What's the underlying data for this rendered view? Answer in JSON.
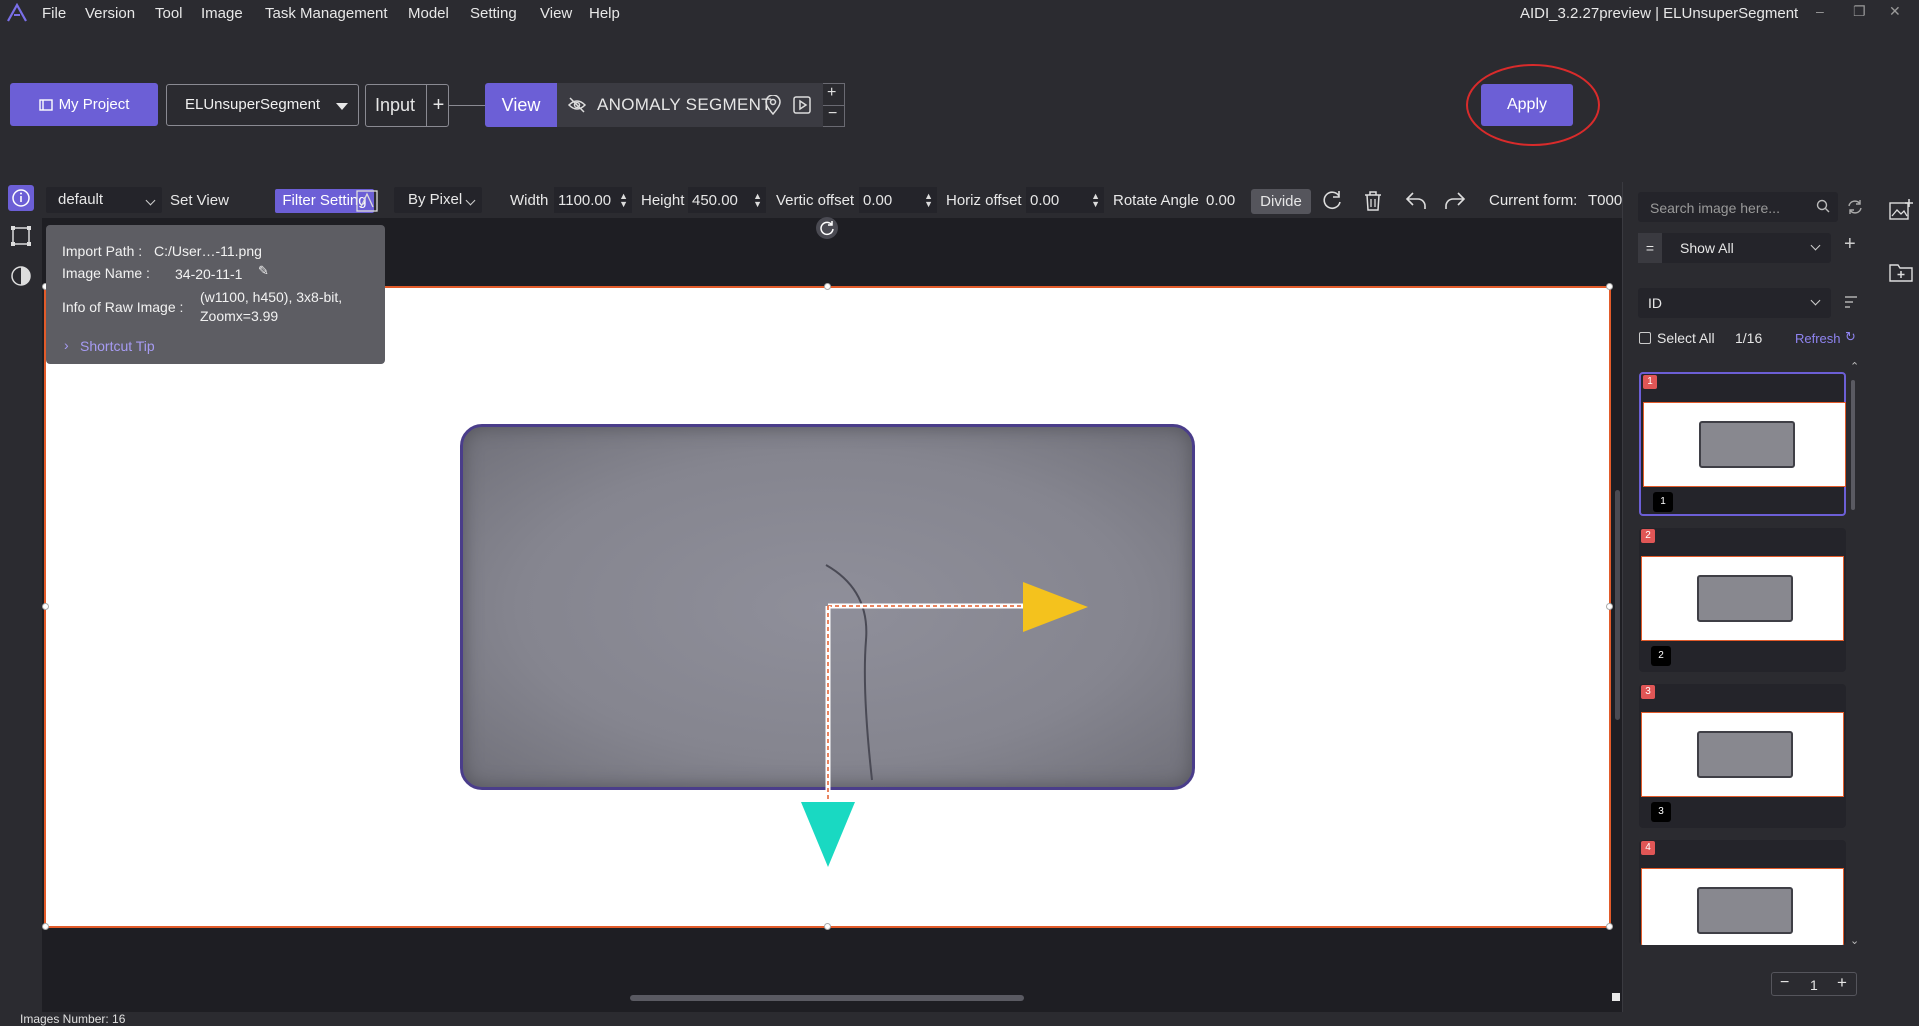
{
  "menubar": {
    "items": [
      "File",
      "Version",
      "Tool",
      "Image",
      "Task Management",
      "Model",
      "Setting",
      "View",
      "Help"
    ],
    "title": "AIDI_3.2.27preview | ELUnsuperSegment"
  },
  "toolbar": {
    "my_project": "My Project",
    "module": "ELUnsuperSegment",
    "input": "Input",
    "input_plus": "+",
    "view": "View",
    "anomaly": "ANOMALY SEGMENT",
    "plus": "+",
    "minus": "−",
    "apply": "Apply",
    "apply_highlight_color": "#d92b2b"
  },
  "subbar": {
    "view_name": "default",
    "set_view": "Set View",
    "filter_setting": "Filter Setting",
    "unit": "By Pixel",
    "width_label": "Width",
    "width_value": "1100.00",
    "height_label": "Height",
    "height_value": "450.00",
    "vertic_label": "Vertic offset",
    "vertic_value": "0.00",
    "horiz_label": "Horiz offset",
    "horiz_value": "0.00",
    "rotate_label": "Rotate Angle",
    "rotate_value": "0.00",
    "divide": "Divide",
    "current_form": "Current form:",
    "current_form_value": "T000"
  },
  "info": {
    "import_path_label": "Import Path :",
    "import_path": "C:/User…-11.png",
    "image_name_label": "Image Name :",
    "image_name": "34-20-11-1",
    "raw_label": "Info of Raw Image :",
    "raw_line1": "(w1100, h450), 3x8-bit,",
    "raw_line2": "Zoomx=3.99",
    "shortcut": "Shortcut Tip"
  },
  "right": {
    "search_placeholder": "Search image here...",
    "eq": "=",
    "show_all": "Show All",
    "sort": "ID",
    "select_all": "Select All",
    "count": "1/16",
    "refresh": "Refresh",
    "thumbs": [
      {
        "badge": "1",
        "num": "1"
      },
      {
        "badge": "2",
        "num": "2"
      },
      {
        "badge": "3",
        "num": "3"
      },
      {
        "badge": "4",
        "num": ""
      }
    ],
    "page": "1"
  },
  "status": {
    "images_number": "Images Number: 16"
  },
  "colors": {
    "accent": "#6c5fd6",
    "frame": "#e25b2a",
    "arrow_x": "#f4c21d",
    "arrow_y": "#19d9c2"
  }
}
